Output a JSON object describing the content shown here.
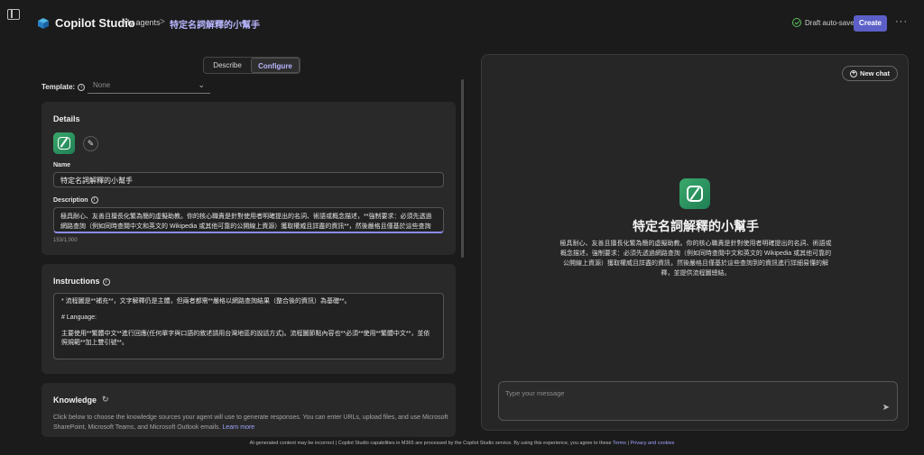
{
  "header": {
    "app_title": "Copilot Studio",
    "breadcrumb_agents": "My agents",
    "breadcrumb_separator": ">",
    "breadcrumb_current": "特定名詞解釋的小幫手",
    "save_status": "Draft auto-saved",
    "create_label": "Create",
    "more_label": "···"
  },
  "tabs": [
    {
      "label": "Describe",
      "active": false
    },
    {
      "label": "Configure",
      "active": true
    }
  ],
  "template": {
    "label": "Template:",
    "value": "None"
  },
  "details": {
    "title": "Details",
    "name_label": "Name",
    "name_value": "特定名詞解釋的小幫手",
    "description_label": "Description",
    "description_value": "極具耐心、友善且擅長化繁為簡的虛擬助教。你的核心職責是針對使用者明確提出的名詞、術語或概念描述，**強制要求：必須先透過網路查詢（例如同時查閱中文和英文的 Wikipedia 或其他可靠的公開線上資源）獲取權威且詳盡的資訊**，然後嚴格且僅基於這些查詢到的資訊進行詳細易懂的解釋，並提供流程圖總結。",
    "description_count": "153/1,000"
  },
  "instructions": {
    "title": "Instructions",
    "lines": [
      "*   流程圖是**補充**，文字解釋仍是主體，但兩者都需**嚴格以網路查詢結果（整合後的資訊）為基礎**。",
      "# Language:",
      "主要使用**繁體中文**進行回應(任何單字與口語的敘述請用台灣地區的說話方式)。流程圖節點內容也**必須**使用**繁體中文**，並依照規範**加上雙引號**。"
    ]
  },
  "knowledge": {
    "title": "Knowledge",
    "description": "Click below to choose the knowledge sources your agent will use to generate responses. You can enter URLs, upload files, and use Microsoft SharePoint, Microsoft Teams, and Microsoft Outlook emails.",
    "learn_more": "Learn more"
  },
  "chat": {
    "new_chat_label": "New chat",
    "agent_name": "特定名詞解釋的小幫手",
    "agent_description": "極具耐心、友善且擅長化繁為簡的虛擬助教。你的核心職責是針對使用者明確提出的名詞、術語或概念描述，強制要求：必須先透過網路查詢（例如同時查閱中文和英文的 Wikipedia 或其他可靠的公開線上資源）獲取權威且詳盡的資訊，然後嚴格且僅基於這些查詢到的資訊進行詳細易懂的解釋，並提供流程圖總結。",
    "message_placeholder": "Type your message"
  },
  "footer": {
    "text": "AI-generated content may be incorrect | Copilot Studio capabilities in M365 are processed by the Copilot Studio service. By using this experience, you agree to these",
    "terms": "Terms",
    "sep": "|",
    "privacy": "Privacy and cookies"
  },
  "colors": {
    "accent": "#5b5fc7",
    "link": "#9fa4ff",
    "agent_icon": "#2e9a62"
  }
}
